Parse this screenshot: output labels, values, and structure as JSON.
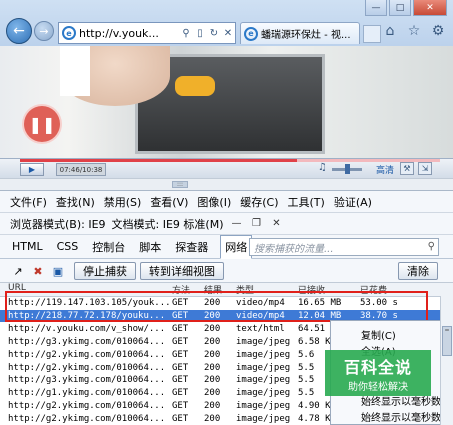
{
  "browser": {
    "address_text": "http://v.youk...",
    "tab_label": "蟠瑞源环保灶 - 视...",
    "window_controls": [
      "minimize-icon",
      "maximize-icon",
      "close-icon"
    ]
  },
  "player": {
    "time": "07:46/10:38",
    "quality_label": "高清",
    "progress_fraction": 0.66
  },
  "devtools": {
    "menu": [
      "文件(F)",
      "查找(N)",
      "禁用(S)",
      "查看(V)",
      "图像(I)",
      "缓存(C)",
      "工具(T)",
      "验证(A)"
    ],
    "browser_mode": "浏览器模式(B): IE9",
    "doc_mode": "文档模式: IE9 标准(M)",
    "tabs": [
      "HTML",
      "CSS",
      "控制台",
      "脚本",
      "探查器",
      "网络"
    ],
    "active_tab": "网络",
    "search_placeholder": "搜索捕获的流量...",
    "stop_capture": "停止捕获",
    "detail_view": "转到详细视图",
    "clear": "清除",
    "columns": [
      "URL",
      "方法",
      "结果",
      "类型",
      "已接收",
      "已花费"
    ],
    "rows": [
      {
        "url": "http://119.147.103.105/youk...",
        "method": "GET",
        "result": "200",
        "type": "video/mp4",
        "received": "16.65 MB",
        "time": "53.00 s"
      },
      {
        "url": "http://218.77.72.178/youku...",
        "method": "GET",
        "result": "200",
        "type": "video/mp4",
        "received": "12.04 MB",
        "time": "38.70 s"
      },
      {
        "url": "http://v.youku.com/v_show/...",
        "method": "GET",
        "result": "200",
        "type": "text/html",
        "received": "64.51 KB",
        "time": "1.05 s"
      },
      {
        "url": "http://g3.ykimg.com/010064...",
        "method": "GET",
        "result": "200",
        "type": "image/jpeg",
        "received": "6.58 KB",
        "time": ""
      },
      {
        "url": "http://g2.ykimg.com/010064...",
        "method": "GET",
        "result": "200",
        "type": "image/jpeg",
        "received": "5.6",
        "time": ""
      },
      {
        "url": "http://g2.ykimg.com/010064...",
        "method": "GET",
        "result": "200",
        "type": "image/jpeg",
        "received": "5.5",
        "time": ""
      },
      {
        "url": "http://g3.ykimg.com/010064...",
        "method": "GET",
        "result": "200",
        "type": "image/jpeg",
        "received": "5.5",
        "time": ""
      },
      {
        "url": "http://g1.ykimg.com/010064...",
        "method": "GET",
        "result": "200",
        "type": "image/jpeg",
        "received": "5.5",
        "time": ""
      },
      {
        "url": "http://g2.ykimg.com/010064...",
        "method": "GET",
        "result": "200",
        "type": "image/jpeg",
        "received": "4.90 KB",
        "time": ""
      },
      {
        "url": "http://g2.ykimg.com/010064...",
        "method": "GET",
        "result": "200",
        "type": "image/jpeg",
        "received": "4.78 KB",
        "time": ""
      }
    ],
    "selected_row": 1,
    "context_menu": [
      "复制(C)",
      "全选(A)",
      "始终显示以毫秒数表示",
      "始终显示以毫秒数表示"
    ]
  },
  "watermark": {
    "title": "百科全说",
    "subtitle": "助你轻松解决"
  }
}
